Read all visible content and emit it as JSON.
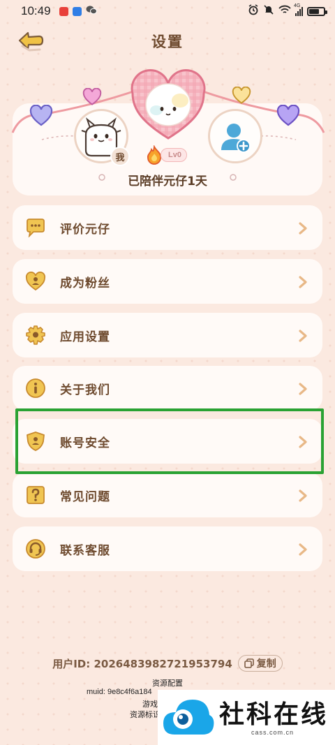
{
  "status_bar": {
    "time": "10:49",
    "network": "4G"
  },
  "header": {
    "title": "设置"
  },
  "profile": {
    "me_label": "我",
    "level": "Lv0",
    "companion_text": "已陪伴元仔1天"
  },
  "menu": [
    {
      "label": "评价元仔",
      "icon": "chat-bubble-icon"
    },
    {
      "label": "成为粉丝",
      "icon": "heart-person-icon"
    },
    {
      "label": "应用设置",
      "icon": "gear-icon"
    },
    {
      "label": "关于我们",
      "icon": "info-icon"
    },
    {
      "label": "账号安全",
      "icon": "shield-icon"
    },
    {
      "label": "常见问题",
      "icon": "question-icon"
    },
    {
      "label": "联系客服",
      "icon": "headset-icon"
    }
  ],
  "footer": {
    "user_id": "用户ID: 2026483982721953794",
    "copy_label": "复制",
    "resource_config": "资源配置",
    "muid": "muid: 9e8c4f6a184",
    "game": "游戏",
    "resource_tag": "资源标识"
  },
  "watermark": {
    "name": "社科在线",
    "domain": "cass.com.cn"
  },
  "colors": {
    "background": "#fbe9e0",
    "card": "#fffaf7",
    "text_brown": "#6e4a2e",
    "icon_gold": "#e8b65a",
    "highlight_green": "#2aa233"
  }
}
